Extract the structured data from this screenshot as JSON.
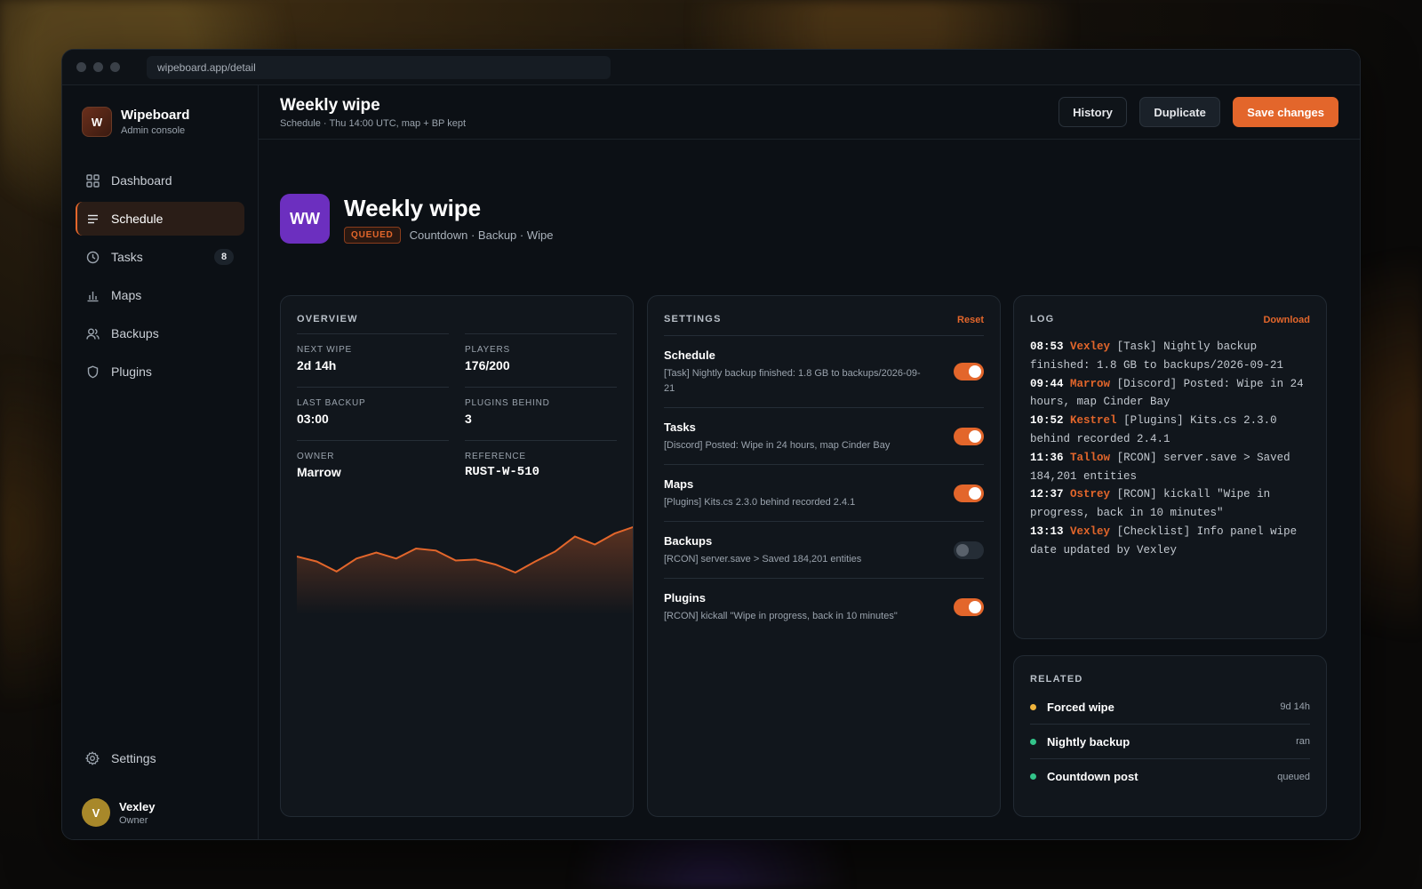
{
  "browser": {
    "url": "wipeboard.app/detail"
  },
  "brand": {
    "logo": "W",
    "name": "Wipeboard",
    "subtitle": "Admin console"
  },
  "sidebar": {
    "items": [
      {
        "label": "Dashboard",
        "icon": "grid-icon"
      },
      {
        "label": "Schedule",
        "icon": "list-icon",
        "active": true
      },
      {
        "label": "Tasks",
        "icon": "clock-icon",
        "badge": "8"
      },
      {
        "label": "Maps",
        "icon": "bar-chart-icon"
      },
      {
        "label": "Backups",
        "icon": "users-icon"
      },
      {
        "label": "Plugins",
        "icon": "shield-icon"
      }
    ],
    "settings_label": "Settings",
    "user": {
      "initial": "V",
      "name": "Vexley",
      "role": "Owner"
    }
  },
  "header": {
    "title": "Weekly wipe",
    "subtitle": "Schedule · Thu 14:00 UTC, map + BP kept",
    "buttons": {
      "history": "History",
      "duplicate": "Duplicate",
      "save": "Save changes"
    }
  },
  "hero": {
    "logo": "WW",
    "title": "Weekly wipe",
    "status": "QUEUED",
    "tags": "Countdown · Backup · Wipe"
  },
  "overview": {
    "title": "OVERVIEW",
    "fields": [
      {
        "label": "NEXT WIPE",
        "value": "2d 14h"
      },
      {
        "label": "PLAYERS",
        "value": "176/200"
      },
      {
        "label": "LAST BACKUP",
        "value": "03:00"
      },
      {
        "label": "PLUGINS BEHIND",
        "value": "3"
      },
      {
        "label": "OWNER",
        "value": "Marrow"
      },
      {
        "label": "REFERENCE",
        "value": "RUST-W-510"
      }
    ],
    "sparkline": [
      40,
      35,
      25,
      38,
      44,
      38,
      48,
      46,
      36,
      37,
      32,
      24,
      35,
      45,
      60,
      52,
      63,
      70
    ]
  },
  "settings": {
    "title": "SETTINGS",
    "reset": "Reset",
    "rows": [
      {
        "name": "Schedule",
        "desc": "[Task] Nightly backup finished: 1.8 GB to backups/2026-09-21",
        "on": true
      },
      {
        "name": "Tasks",
        "desc": "[Discord] Posted: Wipe in 24 hours, map Cinder Bay",
        "on": true
      },
      {
        "name": "Maps",
        "desc": "[Plugins] Kits.cs 2.3.0 behind recorded 2.4.1",
        "on": true
      },
      {
        "name": "Backups",
        "desc": "[RCON] server.save > Saved 184,201 entities",
        "on": false
      },
      {
        "name": "Plugins",
        "desc": "[RCON] kickall \"Wipe in progress, back in 10 minutes\"",
        "on": true
      }
    ]
  },
  "log": {
    "title": "LOG",
    "download": "Download",
    "entries": [
      {
        "time": "08:53",
        "user": "Vexley",
        "text": "[Task] Nightly backup finished: 1.8 GB to backups/2026-09-21"
      },
      {
        "time": "09:44",
        "user": "Marrow",
        "text": "[Discord] Posted: Wipe in 24 hours, map Cinder Bay"
      },
      {
        "time": "10:52",
        "user": "Kestrel",
        "text": "[Plugins] Kits.cs 2.3.0 behind recorded 2.4.1"
      },
      {
        "time": "11:36",
        "user": "Tallow",
        "text": "[RCON] server.save > Saved 184,201 entities"
      },
      {
        "time": "12:37",
        "user": "Ostrey",
        "text": "[RCON] kickall \"Wipe in progress, back in 10 minutes\""
      },
      {
        "time": "13:13",
        "user": "Vexley",
        "text": "[Checklist] Info panel wipe date updated by Vexley"
      }
    ]
  },
  "related": {
    "title": "RELATED",
    "items": [
      {
        "name": "Forced wipe",
        "meta": "9d 14h",
        "color": "#f0b43c"
      },
      {
        "name": "Nightly backup",
        "meta": "ran",
        "color": "#33c48a"
      },
      {
        "name": "Countdown post",
        "meta": "queued",
        "color": "#33c48a"
      }
    ]
  },
  "colors": {
    "accent": "#e3662b",
    "hero_logo": "#6c2fbf"
  }
}
